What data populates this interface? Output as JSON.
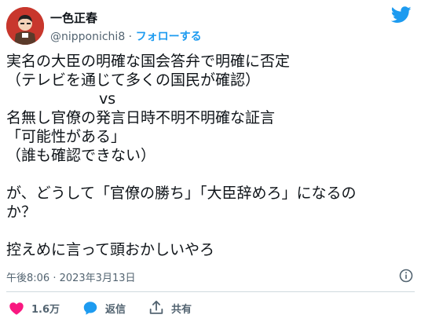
{
  "author": {
    "display_name": "一色正春",
    "handle": "@nipponichi8",
    "separator": " · ",
    "follow_label": "フォローする"
  },
  "tweet": {
    "lines": [
      "実名の大臣の明確な国会答弁で明確に否定",
      "（テレビを通じて多くの国民が確認）",
      "vs",
      "名無し官僚の発言日時不明不明確な証言",
      "「可能性がある」",
      "（誰も確認できない）",
      "",
      "が、どうして「官僚の勝ち」「大臣辞めろ」になるの",
      "か？",
      "",
      "控えめに言って頭おかしいやろ"
    ],
    "timestamp": "午後8:06 · 2023年3月13日"
  },
  "actions": {
    "like_count": "1.6万",
    "reply_label": "返信",
    "share_label": "共有"
  },
  "colors": {
    "brand_blue": "#1d9bf0",
    "like_pink": "#f91880",
    "text_primary": "#0f1419",
    "text_secondary": "#536471"
  },
  "icons": {
    "brand": "twitter-bird-icon",
    "info": "info-icon",
    "like": "heart-icon",
    "reply": "reply-bubble-icon",
    "share": "share-upload-icon"
  }
}
